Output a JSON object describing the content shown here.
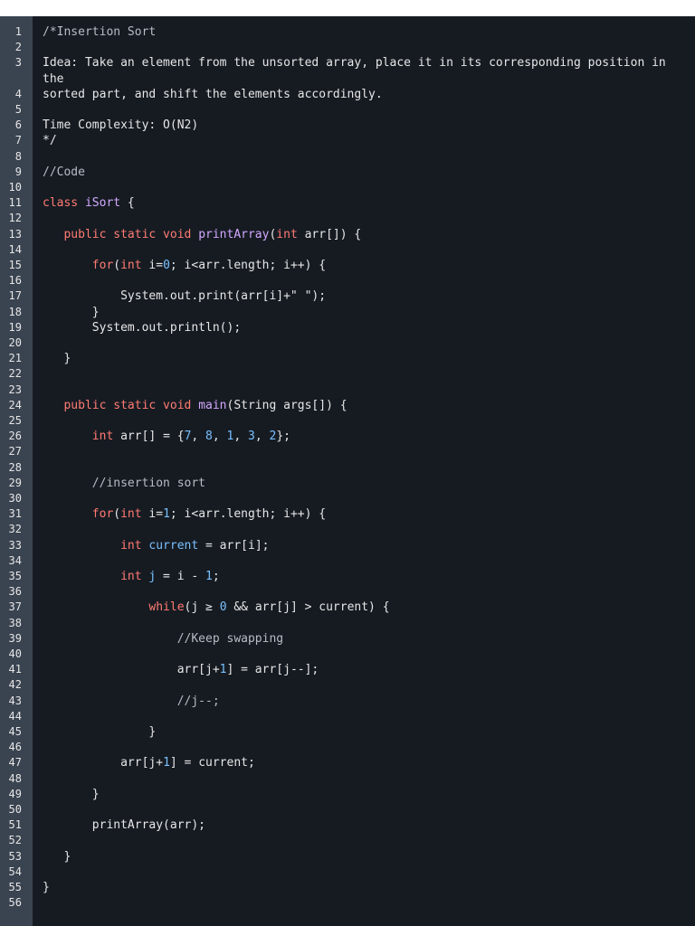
{
  "colors": {
    "background": "#161b22",
    "gutter": "#3a4350",
    "text": "#e6e6e6",
    "keyword": "#ff7b72",
    "function": "#d2a8ff",
    "number": "#79c0ff",
    "comment": "#b8bcc4"
  },
  "lines": [
    {
      "n": "1",
      "tokens": [
        {
          "t": "/*Insertion Sort",
          "c": "com"
        }
      ]
    },
    {
      "n": "2",
      "tokens": []
    },
    {
      "n": "3",
      "tokens": [
        {
          "t": "Idea: Take an element from the unsorted array, place it in its corresponding position in",
          "c": "pl"
        }
      ]
    },
    {
      "n": "",
      "tokens": [
        {
          "t": "the",
          "c": "pl"
        }
      ]
    },
    {
      "n": "4",
      "tokens": [
        {
          "t": "sorted part, and shift the elements accordingly.",
          "c": "pl"
        }
      ]
    },
    {
      "n": "5",
      "tokens": []
    },
    {
      "n": "6",
      "tokens": [
        {
          "t": "Time Complexity: O(N2)",
          "c": "pl"
        }
      ]
    },
    {
      "n": "7",
      "tokens": [
        {
          "t": "*/",
          "c": "pl"
        }
      ]
    },
    {
      "n": "8",
      "tokens": []
    },
    {
      "n": "9",
      "tokens": [
        {
          "t": "//Code",
          "c": "com"
        }
      ]
    },
    {
      "n": "10",
      "tokens": []
    },
    {
      "n": "11",
      "tokens": [
        {
          "t": "class ",
          "c": "kw"
        },
        {
          "t": "iSort",
          "c": "fn"
        },
        {
          "t": " {",
          "c": "pl"
        }
      ]
    },
    {
      "n": "12",
      "tokens": []
    },
    {
      "n": "13",
      "tokens": [
        {
          "t": "   public static void ",
          "c": "kw"
        },
        {
          "t": "printArray",
          "c": "fn"
        },
        {
          "t": "(",
          "c": "pl"
        },
        {
          "t": "int",
          "c": "ty"
        },
        {
          "t": " arr[]) {",
          "c": "pl"
        }
      ]
    },
    {
      "n": "14",
      "tokens": []
    },
    {
      "n": "15",
      "tokens": [
        {
          "t": "       for",
          "c": "kw"
        },
        {
          "t": "(",
          "c": "pl"
        },
        {
          "t": "int",
          "c": "ty"
        },
        {
          "t": " i=",
          "c": "pl"
        },
        {
          "t": "0",
          "c": "num"
        },
        {
          "t": "; i<arr.length; i++) {",
          "c": "pl"
        }
      ]
    },
    {
      "n": "16",
      "tokens": []
    },
    {
      "n": "17",
      "tokens": [
        {
          "t": "           System.out.print(arr[i]+\" \");",
          "c": "pl"
        }
      ]
    },
    {
      "n": "18",
      "tokens": [
        {
          "t": "       }",
          "c": "pl"
        }
      ]
    },
    {
      "n": "19",
      "tokens": [
        {
          "t": "       System.out.println();",
          "c": "pl"
        }
      ]
    },
    {
      "n": "20",
      "tokens": []
    },
    {
      "n": "21",
      "tokens": [
        {
          "t": "   }",
          "c": "pl"
        }
      ]
    },
    {
      "n": "22",
      "tokens": []
    },
    {
      "n": "23",
      "tokens": []
    },
    {
      "n": "24",
      "tokens": [
        {
          "t": "   public static void ",
          "c": "kw"
        },
        {
          "t": "main",
          "c": "fn"
        },
        {
          "t": "(String args[]) {",
          "c": "pl"
        }
      ]
    },
    {
      "n": "25",
      "tokens": []
    },
    {
      "n": "26",
      "tokens": [
        {
          "t": "       int",
          "c": "ty"
        },
        {
          "t": " arr[] = {",
          "c": "pl"
        },
        {
          "t": "7",
          "c": "num"
        },
        {
          "t": ", ",
          "c": "pl"
        },
        {
          "t": "8",
          "c": "num"
        },
        {
          "t": ", ",
          "c": "pl"
        },
        {
          "t": "1",
          "c": "num"
        },
        {
          "t": ", ",
          "c": "pl"
        },
        {
          "t": "3",
          "c": "num"
        },
        {
          "t": ", ",
          "c": "pl"
        },
        {
          "t": "2",
          "c": "num"
        },
        {
          "t": "};",
          "c": "pl"
        }
      ]
    },
    {
      "n": "27",
      "tokens": []
    },
    {
      "n": "28",
      "tokens": []
    },
    {
      "n": "29",
      "tokens": [
        {
          "t": "       //insertion sort",
          "c": "com"
        }
      ]
    },
    {
      "n": "30",
      "tokens": []
    },
    {
      "n": "31",
      "tokens": [
        {
          "t": "       for",
          "c": "kw"
        },
        {
          "t": "(",
          "c": "pl"
        },
        {
          "t": "int",
          "c": "ty"
        },
        {
          "t": " i=",
          "c": "pl"
        },
        {
          "t": "1",
          "c": "num"
        },
        {
          "t": "; i<arr.length; i++) {",
          "c": "pl"
        }
      ]
    },
    {
      "n": "32",
      "tokens": []
    },
    {
      "n": "33",
      "tokens": [
        {
          "t": "           int",
          "c": "ty"
        },
        {
          "t": " current",
          "c": "var"
        },
        {
          "t": " = arr[i];",
          "c": "pl"
        }
      ]
    },
    {
      "n": "34",
      "tokens": []
    },
    {
      "n": "35",
      "tokens": [
        {
          "t": "           int",
          "c": "ty"
        },
        {
          "t": " j",
          "c": "var"
        },
        {
          "t": " = i - ",
          "c": "pl"
        },
        {
          "t": "1",
          "c": "num"
        },
        {
          "t": ";",
          "c": "pl"
        }
      ]
    },
    {
      "n": "36",
      "tokens": []
    },
    {
      "n": "37",
      "tokens": [
        {
          "t": "               while",
          "c": "kw"
        },
        {
          "t": "(j ≥ ",
          "c": "pl"
        },
        {
          "t": "0",
          "c": "num"
        },
        {
          "t": " && arr[j] > current) {",
          "c": "pl"
        }
      ]
    },
    {
      "n": "38",
      "tokens": []
    },
    {
      "n": "39",
      "tokens": [
        {
          "t": "                   //Keep swapping",
          "c": "com"
        }
      ]
    },
    {
      "n": "40",
      "tokens": []
    },
    {
      "n": "41",
      "tokens": [
        {
          "t": "                   arr[j+",
          "c": "pl"
        },
        {
          "t": "1",
          "c": "num"
        },
        {
          "t": "] = arr[j--];",
          "c": "pl"
        }
      ]
    },
    {
      "n": "42",
      "tokens": []
    },
    {
      "n": "43",
      "tokens": [
        {
          "t": "                   //j--;",
          "c": "com"
        }
      ]
    },
    {
      "n": "44",
      "tokens": []
    },
    {
      "n": "45",
      "tokens": [
        {
          "t": "               }",
          "c": "pl"
        }
      ]
    },
    {
      "n": "46",
      "tokens": []
    },
    {
      "n": "47",
      "tokens": [
        {
          "t": "           arr[j+",
          "c": "pl"
        },
        {
          "t": "1",
          "c": "num"
        },
        {
          "t": "] = current;",
          "c": "pl"
        }
      ]
    },
    {
      "n": "48",
      "tokens": []
    },
    {
      "n": "49",
      "tokens": [
        {
          "t": "       }",
          "c": "pl"
        }
      ]
    },
    {
      "n": "50",
      "tokens": []
    },
    {
      "n": "51",
      "tokens": [
        {
          "t": "       printArray(arr);",
          "c": "pl"
        }
      ]
    },
    {
      "n": "52",
      "tokens": []
    },
    {
      "n": "53",
      "tokens": [
        {
          "t": "   }",
          "c": "pl"
        }
      ]
    },
    {
      "n": "54",
      "tokens": []
    },
    {
      "n": "55",
      "tokens": [
        {
          "t": "}",
          "c": "pl"
        }
      ]
    },
    {
      "n": "56",
      "tokens": []
    }
  ]
}
